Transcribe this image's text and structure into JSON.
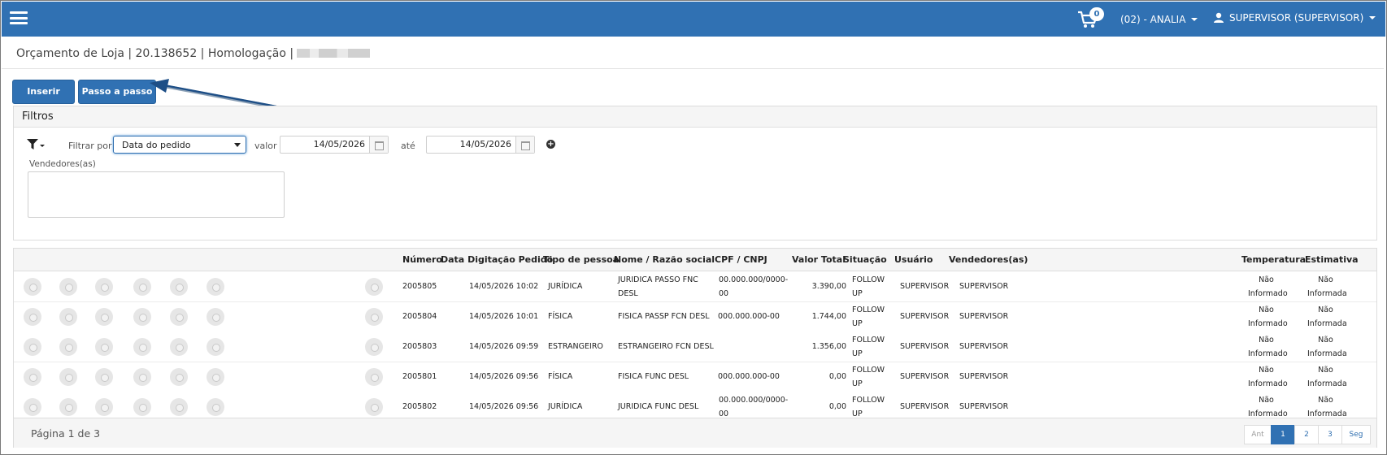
{
  "header": {
    "cart_count": "0",
    "store": "(02) - ANALIA",
    "user": "SUPERVISOR (SUPERVISOR)"
  },
  "breadcrumb": "Orçamento de Loja | 20.138652 | Homologação |",
  "toolbar": {
    "insert_label": "Inserir",
    "wizard_label": "Passo a passo"
  },
  "filters": {
    "title": "Filtros",
    "filter_by_label": "Filtrar por",
    "filter_by_value": "Data do pedido",
    "value_label": "valor",
    "from_date": "14/05/2026",
    "to_label": "até",
    "to_date": "14/05/2026",
    "sellers_label": "Vendedores(as)"
  },
  "table": {
    "headers": {
      "numero": "Número",
      "data": "Data Digitação Pedido",
      "tipo": "Tipo de pessoa",
      "nome": "Nome / Razão social",
      "cpf": "CPF / CNPJ",
      "valor": "Valor Total",
      "situacao": "Situação",
      "usuario": "Usuário",
      "vendedores": "Vendedores(as)",
      "temperatura": "Temperatura",
      "estimativa": "Estimativa"
    },
    "rows": [
      {
        "numero": "2005805",
        "data": "14/05/2026 10:02",
        "tipo": "JURÍDICA",
        "nome1": "JURIDICA PASSO FNC",
        "nome2": "DESL",
        "cpf1": "00.000.000/0000-",
        "cpf2": "00",
        "valor": "3.390,00",
        "sit1": "FOLLOW",
        "sit2": "UP",
        "usuario": "SUPERVISOR",
        "vendedor": "SUPERVISOR",
        "temp1": "Não",
        "temp2": "Informado",
        "est1": "Não",
        "est2": "Informada"
      },
      {
        "numero": "2005804",
        "data": "14/05/2026 10:01",
        "tipo": "FÍSICA",
        "nome1": "FISICA PASSP FCN DESL",
        "nome2": "",
        "cpf1": "000.000.000-00",
        "cpf2": "",
        "valor": "1.744,00",
        "sit1": "FOLLOW",
        "sit2": "UP",
        "usuario": "SUPERVISOR",
        "vendedor": "SUPERVISOR",
        "temp1": "Não",
        "temp2": "Informado",
        "est1": "Não",
        "est2": "Informada"
      },
      {
        "numero": "2005803",
        "data": "14/05/2026 09:59",
        "tipo": "ESTRANGEIRO",
        "nome1": "ESTRANGEIRO FCN DESL",
        "nome2": "",
        "cpf1": "",
        "cpf2": "",
        "valor": "1.356,00",
        "sit1": "FOLLOW",
        "sit2": "UP",
        "usuario": "SUPERVISOR",
        "vendedor": "SUPERVISOR",
        "temp1": "Não",
        "temp2": "Informado",
        "est1": "Não",
        "est2": "Informada"
      },
      {
        "numero": "2005801",
        "data": "14/05/2026 09:56",
        "tipo": "FÍSICA",
        "nome1": "FISICA FUNC DESL",
        "nome2": "",
        "cpf1": "000.000.000-00",
        "cpf2": "",
        "valor": "0,00",
        "sit1": "FOLLOW",
        "sit2": "UP",
        "usuario": "SUPERVISOR",
        "vendedor": "SUPERVISOR",
        "temp1": "Não",
        "temp2": "Informado",
        "est1": "Não",
        "est2": "Informada"
      },
      {
        "numero": "2005802",
        "data": "14/05/2026 09:56",
        "tipo": "JURÍDICA",
        "nome1": "JURIDICA FUNC DESL",
        "nome2": "",
        "cpf1": "00.000.000/0000-",
        "cpf2": "00",
        "valor": "0,00",
        "sit1": "FOLLOW",
        "sit2": "UP",
        "usuario": "SUPERVISOR",
        "vendedor": "SUPERVISOR",
        "temp1": "Não",
        "temp2": "Informado",
        "est1": "Não",
        "est2": "Informada"
      }
    ]
  },
  "pagination": {
    "info": "Página 1 de 3",
    "prev": "Ant",
    "pages": [
      "1",
      "2",
      "3"
    ],
    "next": "Seg"
  },
  "row_action_icons": [
    "edit-icon",
    "view-icon",
    "copy-icon",
    "list-icon",
    "edit-note-icon",
    "history-icon"
  ],
  "colors": {
    "brand": "#3071b3"
  }
}
